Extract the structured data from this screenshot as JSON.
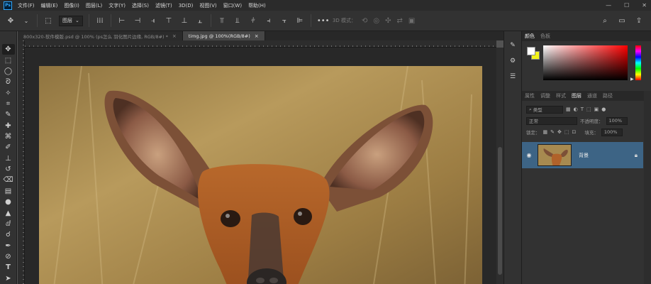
{
  "app": {
    "logo": "Ps",
    "menus": [
      "文件(F)",
      "编辑(E)",
      "图像(I)",
      "图层(L)",
      "文字(Y)",
      "选择(S)",
      "滤镜(T)",
      "3D(D)",
      "视图(V)",
      "窗口(W)",
      "帮助(H)"
    ],
    "window_controls": {
      "minimize": "—",
      "maximize": "☐",
      "close": "✕"
    }
  },
  "options_bar": {
    "layer_select": "图层",
    "mode_3d_label": "3D 模式："
  },
  "tabs": [
    {
      "label": "800x320-软件模版.psd @ 100% (ps怎么 羽化图片边缘, RGB/8#) *",
      "close": "×",
      "active": false
    },
    {
      "label": "timg.jpg @ 100%(RGB/8#)",
      "close": "×",
      "active": true
    }
  ],
  "color_panel": {
    "tabs": [
      "颜色",
      "色板"
    ],
    "foreground": "#ffffff",
    "background": "#f2f21a"
  },
  "layers_panel": {
    "tabs": [
      "属性",
      "调整",
      "样式",
      "图层",
      "通道",
      "路径"
    ],
    "kind_label": "类型",
    "blend_mode": "正常",
    "opacity_label": "不透明度：",
    "opacity_value": "100%",
    "lock_label": "锁定：",
    "fill_label": "填充：",
    "fill_value": "100%",
    "layers": [
      {
        "name": "背景",
        "visible": true,
        "locked": true,
        "selected": true
      }
    ]
  }
}
